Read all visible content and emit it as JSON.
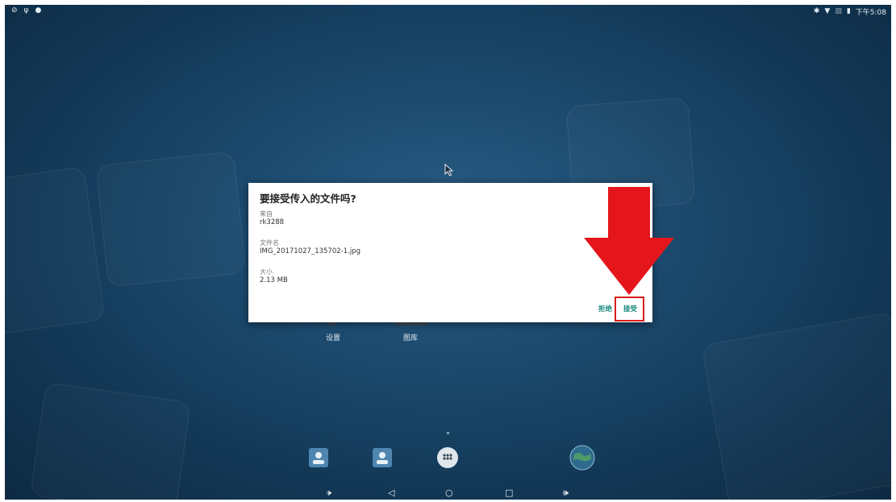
{
  "statusbar": {
    "left_icons": [
      "notification-icon",
      "usb-icon",
      "location-icon"
    ],
    "right_icons": [
      "bluetooth-icon",
      "wifi-icon",
      "no-sim-icon",
      "battery-icon"
    ],
    "time": "下午5:08"
  },
  "desktop": {
    "app_labels": [
      "设置",
      "图库"
    ]
  },
  "dialog": {
    "title": "要接受传入的文件吗?",
    "from_label": "来自",
    "from_value": "rk3288",
    "filename_label": "文件名",
    "filename_value": "IMG_20171027_135702-1.jpg",
    "size_label": "大小",
    "size_value": "2.13 MB",
    "decline_label": "拒绝",
    "accept_label": "接受"
  },
  "annotation": {
    "highlight_color": "#d81e1e",
    "arrow_color": "#e4161c"
  },
  "dock": {
    "icons": [
      "contacts-icon",
      "contacts-icon",
      "app-drawer-icon",
      "browser-globe-icon"
    ]
  },
  "navbar": {
    "icons": [
      "volume-down-icon",
      "back-icon",
      "home-icon",
      "recents-icon",
      "volume-up-icon"
    ]
  },
  "colors": {
    "accent": "#1d8a80",
    "wallpaper": "#1c4a6e"
  }
}
